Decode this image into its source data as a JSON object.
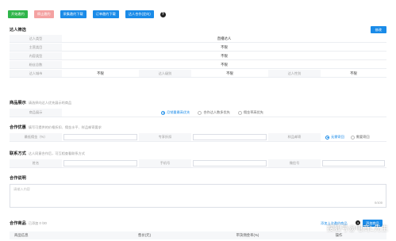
{
  "toolbar": {
    "buttons": [
      "开始邀约",
      "停止邀约",
      "采集邀约下载",
      "订单邀约下载",
      "达人合作(定向)"
    ],
    "help": "?"
  },
  "talent_filter": {
    "title": "达人筛选",
    "edit": "修改",
    "rows": [
      {
        "label": "达人类型",
        "value": "直播达人"
      },
      {
        "label": "主营类目",
        "value": "不限"
      },
      {
        "label": "内容类型",
        "value": "不限"
      },
      {
        "label": "粉丝总数",
        "value": "不限"
      }
    ],
    "triple": {
      "city_label": "达人城市",
      "city_value": "不限",
      "level_label": "达人级别",
      "level_value": "不限",
      "gender_label": "达人性别",
      "gender_value": "不限"
    }
  },
  "product_display": {
    "title": "商品展示",
    "hint": "请选择向达人优先展示的商品",
    "label": "商品展示",
    "options": [
      "月销量最高优先",
      "合作达人数多优先",
      "佣金率高优先"
    ],
    "selected": 0
  },
  "cooperation": {
    "title": "合作优惠",
    "hint": "填写可提供的价格折扣、佣金水平、样品邮寄要求",
    "commission_label": "最低佣金（%）",
    "discount_label": "专享折扣",
    "sample_label": "样品邮寄",
    "sample_options": [
      "无需寄回",
      "需要寄回"
    ],
    "sample_selected": 0
  },
  "contact": {
    "title": "联系方式",
    "hint": "达人同意合作后，可互相查看联系方式",
    "name_label": "姓名",
    "phone_label": "手机号",
    "wechat_label": "微信号"
  },
  "description": {
    "title": "合作说明",
    "placeholder": "请输入内容",
    "counter": "0/100"
  },
  "products": {
    "title": "合作商品",
    "count": "已添加 0 /30",
    "history_link": "添加上次邀约商品",
    "add_button": "添加商品",
    "columns": [
      "商品信息",
      "售价(元)",
      "带货佣金率(%)",
      "操作"
    ]
  },
  "watermark": "搜狐号@电商L先生",
  "colors": {
    "primary": "#1a8be8",
    "green": "#2fb54a",
    "pink": "#f4a2a2"
  }
}
